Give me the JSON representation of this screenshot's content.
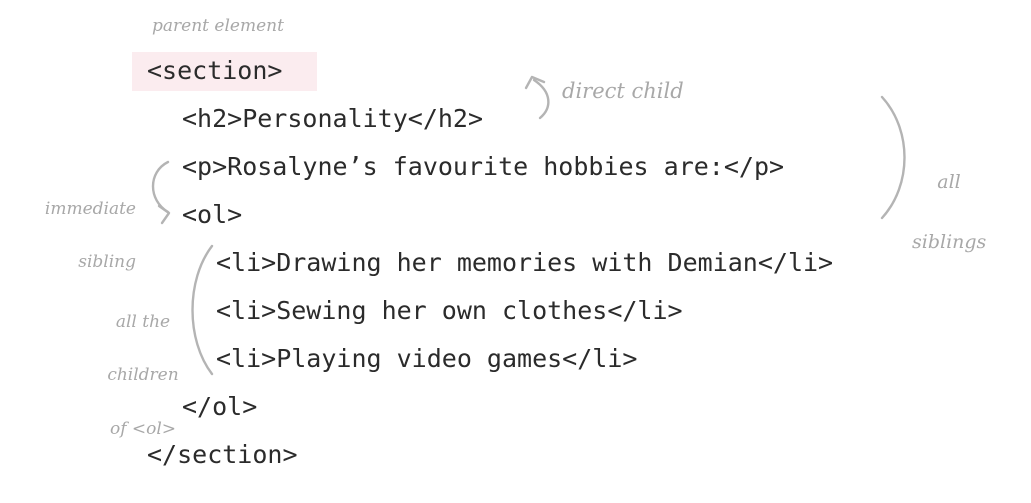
{
  "code_lines": [
    "<section>",
    "<h2>Personality</h2>",
    "<p>Rosalyne’s favourite hobbies are:</p>",
    "<ol>",
    "<li>Drawing her memories with Demian</li>",
    "<li>Sewing her own clothes</li>",
    "<li>Playing video games</li>",
    "</ol>",
    "</section>"
  ],
  "annotations": {
    "parent_element": "parent element",
    "direct_child": "direct child",
    "all_siblings": [
      "all",
      "siblings"
    ],
    "immediate_sibling": [
      "immediate",
      "sibling"
    ],
    "all_children": [
      "all the",
      "children",
      "of <ol>"
    ]
  },
  "colors": {
    "highlight": "#fbecef",
    "annotation": "#a8a8a8",
    "code": "#2b2b2b"
  }
}
